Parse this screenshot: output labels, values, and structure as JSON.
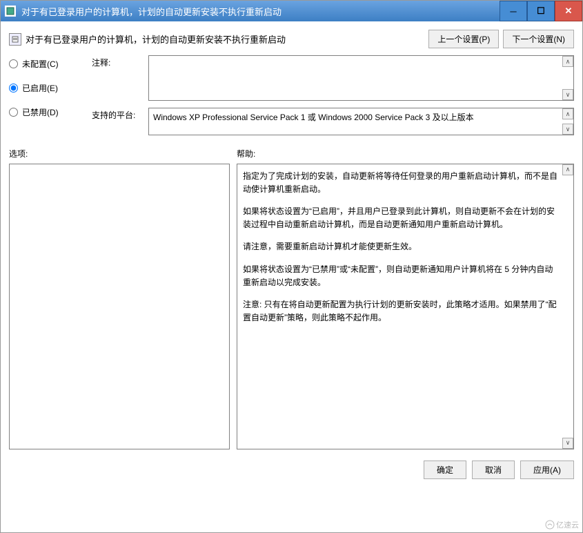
{
  "titlebar": {
    "title": "对于有已登录用户的计算机，计划的自动更新安装不执行重新启动"
  },
  "header": {
    "policy_text": "对于有已登录用户的计算机，计划的自动更新安装不执行重新启动",
    "prev_btn": "上一个设置(P)",
    "next_btn": "下一个设置(N)"
  },
  "state": {
    "not_configured": "未配置(C)",
    "enabled": "已启用(E)",
    "disabled": "已禁用(D)",
    "selected": "enabled"
  },
  "notes": {
    "label": "注释:",
    "value": ""
  },
  "platform": {
    "label": "支持的平台:",
    "value": "Windows XP Professional Service Pack 1 或 Windows 2000 Service Pack 3 及以上版本"
  },
  "sections": {
    "options_label": "选项:",
    "help_label": "帮助:"
  },
  "help": {
    "p1": "指定为了完成计划的安装，自动更新将等待任何登录的用户重新启动计算机，而不是自动使计算机重新启动。",
    "p2": "如果将状态设置为“已启用”，并且用户已登录到此计算机，则自动更新不会在计划的安装过程中自动重新启动计算机，而是自动更新通知用户重新启动计算机。",
    "p3": "请注意，需要重新启动计算机才能使更新生效。",
    "p4": "如果将状态设置为“已禁用”或“未配置”，则自动更新通知用户计算机将在 5 分钟内自动重新启动以完成安装。",
    "p5": "注意: 只有在将自动更新配置为执行计划的更新安装时，此策略才适用。如果禁用了“配置自动更新”策略，则此策略不起作用。"
  },
  "footer": {
    "ok": "确定",
    "cancel": "取消",
    "apply": "应用(A)"
  },
  "watermark": "亿速云"
}
